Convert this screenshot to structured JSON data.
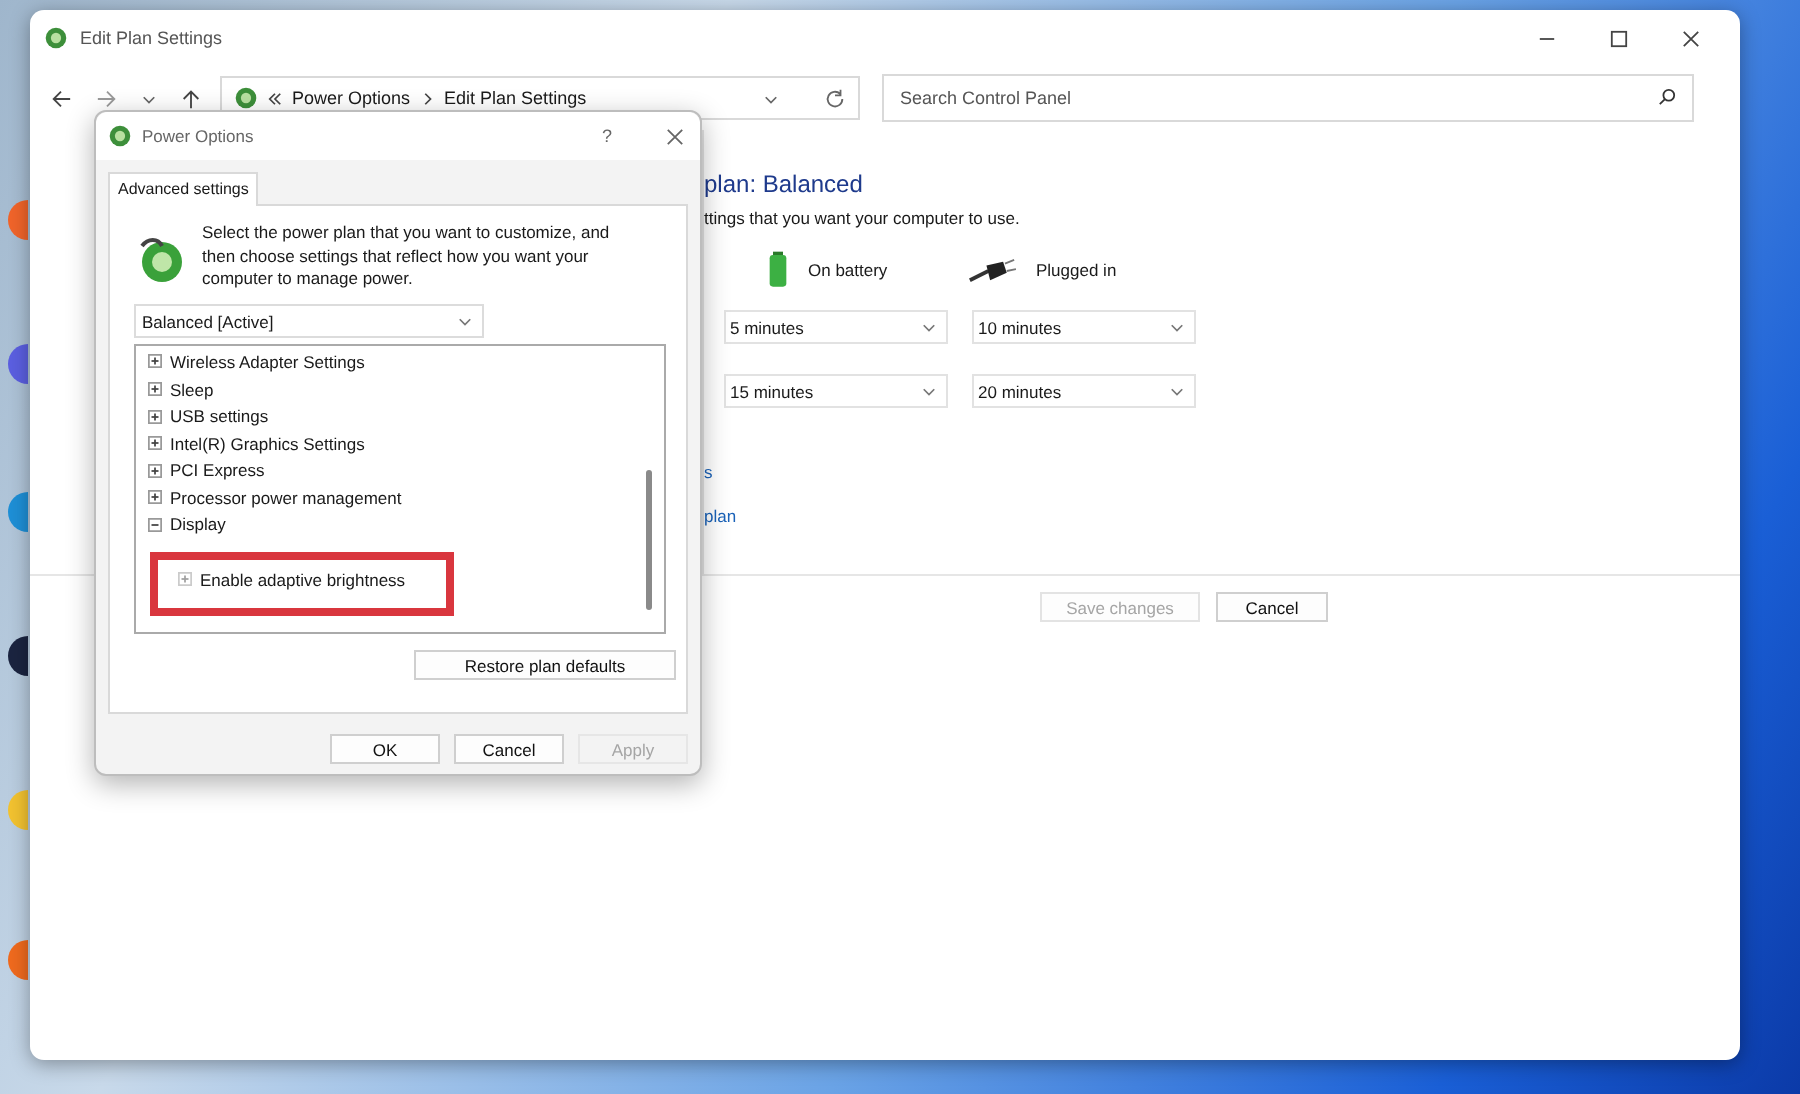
{
  "main_window": {
    "title": "Edit Plan Settings",
    "breadcrumb": [
      "Power Options",
      "Edit Plan Settings"
    ],
    "search": {
      "placeholder": "Search Control Panel"
    },
    "heading": "plan: Balanced",
    "subtitle": "ttings that you want your computer to use.",
    "columns": [
      {
        "kind": "battery",
        "label": "On battery"
      },
      {
        "kind": "plug",
        "label": "Plugged in"
      }
    ],
    "settings_rows": [
      {
        "values": [
          "5 minutes",
          "10 minutes"
        ]
      },
      {
        "values": [
          "15 minutes",
          "20 minutes"
        ]
      }
    ],
    "links": [
      "s",
      "plan"
    ],
    "buttons": [
      {
        "label": "Save changes",
        "disabled": true
      },
      {
        "label": "Cancel",
        "disabled": false
      }
    ]
  },
  "dialog": {
    "title": "Power Options",
    "help": "?",
    "tabs": [
      {
        "label": "Advanced settings",
        "selected": true
      }
    ],
    "description": "Select the power plan that you want to customize, and then choose settings that reflect how you want your computer to manage power.",
    "plan_dropdown": "Balanced [Active]",
    "tree": [
      {
        "label": "Wireless Adapter Settings",
        "expanded": false
      },
      {
        "label": "Sleep",
        "expanded": false
      },
      {
        "label": "USB settings",
        "expanded": false
      },
      {
        "label": "Intel(R) Graphics Settings",
        "expanded": false
      },
      {
        "label": "PCI Express",
        "expanded": false
      },
      {
        "label": "Processor power management",
        "expanded": false
      },
      {
        "label": "Display",
        "expanded": true,
        "children": [
          {
            "label": "Enable adaptive brightness",
            "expanded": false
          }
        ]
      }
    ],
    "restore_button": "Restore plan defaults",
    "buttons": [
      {
        "label": "OK",
        "disabled": false
      },
      {
        "label": "Cancel",
        "disabled": false
      },
      {
        "label": "Apply",
        "disabled": true
      }
    ]
  }
}
